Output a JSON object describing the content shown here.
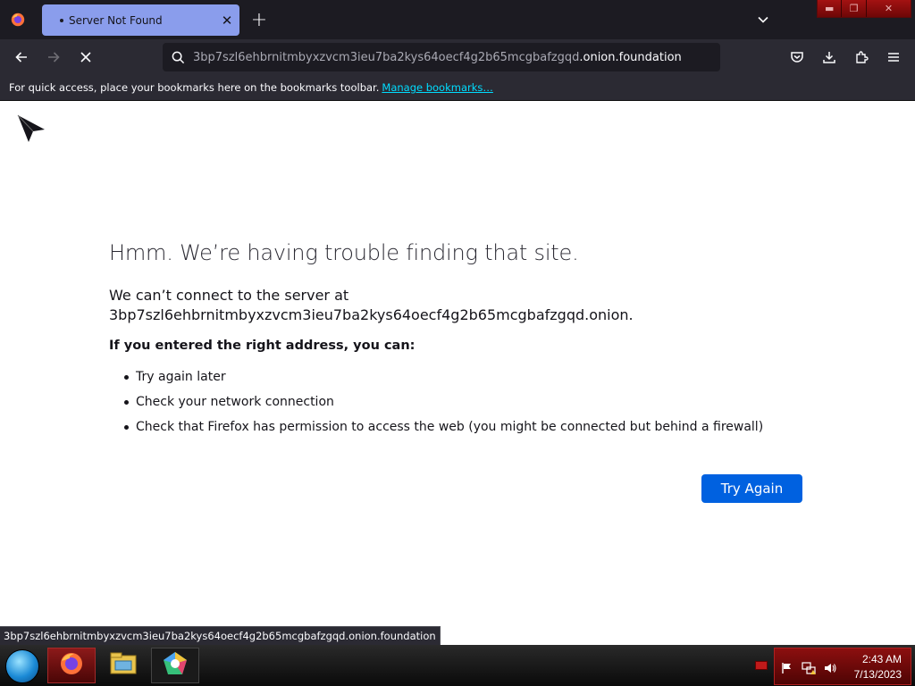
{
  "browser": {
    "tab": {
      "title": "Server Not Found"
    },
    "url": {
      "main": "3bp7szl6ehbrnitmbyxzvcm3ieu7ba2kys64oecf4g2b65mcgbafzgqd",
      "domain": ".onion.foundation"
    },
    "bookmarks_bar": {
      "text": "For quick access, place your bookmarks here on the bookmarks toolbar.",
      "link": "Manage bookmarks…"
    },
    "status_text": "3bp7szl6ehbrnitmbyxzvcm3ieu7ba2kys64oecf4g2b65mcgbafzgqd.onion.foundation"
  },
  "error_page": {
    "title": "Hmm. We’re having trouble finding that site.",
    "desc_line1": "We can’t connect to the server at",
    "desc_line2": "3bp7szl6ehbrnitmbyxzvcm3ieu7ba2kys64oecf4g2b65mcgbafzgqd.onion.",
    "hint": "If you entered the right address, you can:",
    "suggestions": [
      "Try again later",
      "Check your network connection",
      "Check that Firefox has permission to access the web (you might be connected but behind a firewall)"
    ],
    "button": "Try Again"
  },
  "taskbar": {
    "time": "2:43 AM",
    "date": "7/13/2023",
    "apps": [
      "firefox-icon",
      "file-explorer-icon",
      "app-pentagon-icon"
    ]
  },
  "colors": {
    "accent": "#0061e0",
    "tab_active": "#8a9dec",
    "link": "#00ddff",
    "theme_red": "#8c0f0f"
  }
}
